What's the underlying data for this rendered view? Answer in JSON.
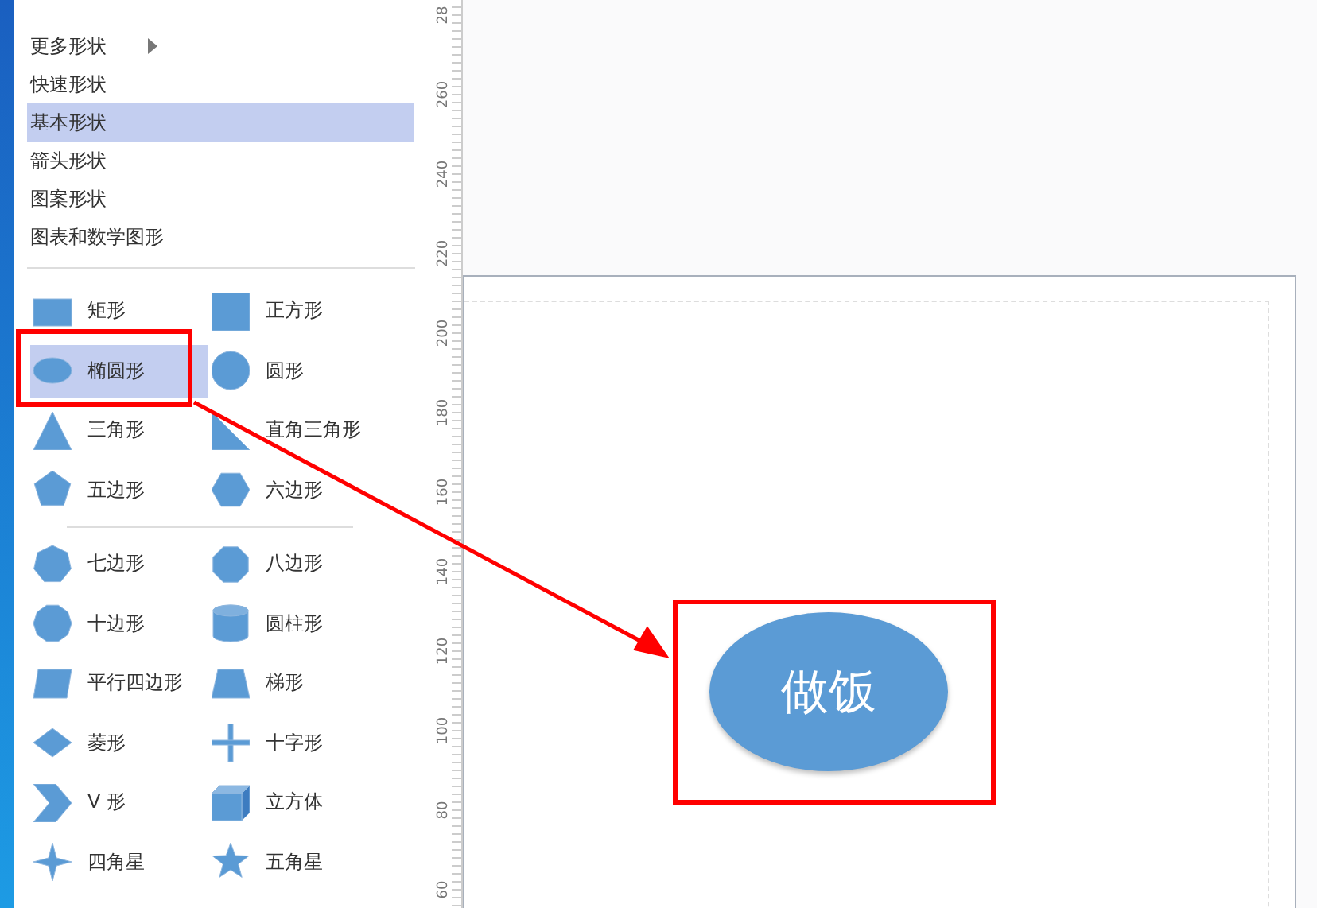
{
  "menu": [
    {
      "label": "更多形状",
      "submenu": true,
      "selected": false
    },
    {
      "label": "快速形状",
      "submenu": false,
      "selected": false
    },
    {
      "label": "基本形状",
      "submenu": false,
      "selected": true
    },
    {
      "label": "箭头形状",
      "submenu": false,
      "selected": false
    },
    {
      "label": "图案形状",
      "submenu": false,
      "selected": false
    },
    {
      "label": "图表和数学图形",
      "submenu": false,
      "selected": false
    }
  ],
  "shape_groups": [
    [
      {
        "kind": "rectangle",
        "label": "矩形",
        "selected": false
      },
      {
        "kind": "square",
        "label": "正方形",
        "selected": false
      },
      {
        "kind": "ellipse",
        "label": "椭圆形",
        "selected": true
      },
      {
        "kind": "circle",
        "label": "圆形",
        "selected": false
      },
      {
        "kind": "triangle",
        "label": "三角形",
        "selected": false
      },
      {
        "kind": "right-triangle",
        "label": "直角三角形",
        "selected": false
      },
      {
        "kind": "pentagon",
        "label": "五边形",
        "selected": false
      },
      {
        "kind": "hexagon",
        "label": "六边形",
        "selected": false
      }
    ],
    [
      {
        "kind": "heptagon",
        "label": "七边形",
        "selected": false
      },
      {
        "kind": "octagon",
        "label": "八边形",
        "selected": false
      },
      {
        "kind": "decagon",
        "label": "十边形",
        "selected": false
      },
      {
        "kind": "cylinder",
        "label": "圆柱形",
        "selected": false
      },
      {
        "kind": "parallelogram",
        "label": "平行四边形",
        "selected": false
      },
      {
        "kind": "trapezoid",
        "label": "梯形",
        "selected": false
      },
      {
        "kind": "diamond",
        "label": "菱形",
        "selected": false
      },
      {
        "kind": "cross",
        "label": "十字形",
        "selected": false
      },
      {
        "kind": "chevron",
        "label": "V 形",
        "selected": false
      },
      {
        "kind": "cube",
        "label": "立方体",
        "selected": false
      },
      {
        "kind": "star4",
        "label": "四角星",
        "selected": false
      },
      {
        "kind": "star5",
        "label": "五角星",
        "selected": false
      }
    ]
  ],
  "ruler": [
    "28",
    "260",
    "240",
    "220",
    "200",
    "180",
    "160",
    "140",
    "120",
    "100",
    "80",
    "60"
  ],
  "canvas": {
    "shapes": [
      {
        "kind": "ellipse",
        "text": "做饭"
      }
    ]
  }
}
